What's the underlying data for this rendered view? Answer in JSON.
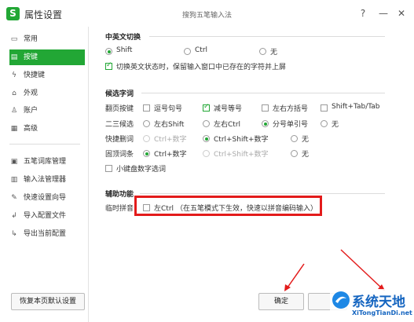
{
  "window": {
    "title": "属性设置",
    "subtitle": "搜狗五笔输入法",
    "help": "?",
    "minimize": "—",
    "close": "✕"
  },
  "sidebar": {
    "items": [
      {
        "label": "常用",
        "icon": "monitor-icon"
      },
      {
        "label": "按键",
        "icon": "keyboard-icon"
      },
      {
        "label": "快捷键",
        "icon": "lightning-icon"
      },
      {
        "label": "外观",
        "icon": "shirt-icon"
      },
      {
        "label": "账户",
        "icon": "user-icon"
      },
      {
        "label": "高级",
        "icon": "grid-icon"
      },
      {
        "label": "五笔词库管理",
        "icon": "book-icon"
      },
      {
        "label": "输入法管理器",
        "icon": "manager-icon"
      },
      {
        "label": "快速设置向导",
        "icon": "wand-icon"
      },
      {
        "label": "导入配置文件",
        "icon": "import-icon"
      },
      {
        "label": "导出当前配置",
        "icon": "export-icon"
      }
    ],
    "active_index": 1,
    "restore_button": "恢复本页默认设置"
  },
  "sections": {
    "zhen": {
      "title": "中英文切换",
      "options": [
        "Shift",
        "Ctrl",
        "无"
      ],
      "selected": 0,
      "checkbox_label": "切换英文状态时，保留输入窗口中已存在的字符并上屏",
      "checkbox_checked": true
    },
    "candidate": {
      "title": "候选字词",
      "rows": [
        {
          "label": "翻页按键",
          "kind": "checkbox",
          "options": [
            "逗号句号",
            "减号等号",
            "左右方括号",
            "Shift+Tab/Tab"
          ],
          "checked": [
            false,
            true,
            false,
            false
          ]
        },
        {
          "label": "二三候选",
          "kind": "radio",
          "options": [
            "左右Shift",
            "左右Ctrl",
            "分号单引号",
            "无"
          ],
          "selected": 2
        },
        {
          "label": "快捷删词",
          "kind": "radio",
          "options": [
            "Ctrl+数字",
            "Ctrl+Shift+数字",
            "无"
          ],
          "selected": 1,
          "disabled": [
            true,
            false,
            false
          ]
        },
        {
          "label": "固顶词条",
          "kind": "radio",
          "options": [
            "Ctrl+数字",
            "Ctrl+Shift+数字",
            "无"
          ],
          "selected": 0,
          "disabled": [
            false,
            true,
            false
          ]
        }
      ],
      "keypad_label": "小键盘数字选词",
      "keypad_checked": false
    },
    "assist": {
      "title": "辅助功能",
      "label": "临时拼音",
      "option": "左Ctrl",
      "note": "（在五笔模式下生效，快速以拼音编码输入）",
      "checked": false
    }
  },
  "buttons": {
    "ok": "确定"
  },
  "watermark": {
    "text": "系统天地",
    "sub": "XiTongTianDi.net"
  },
  "colors": {
    "accent": "#22a735",
    "highlight": "#e31b1b"
  }
}
